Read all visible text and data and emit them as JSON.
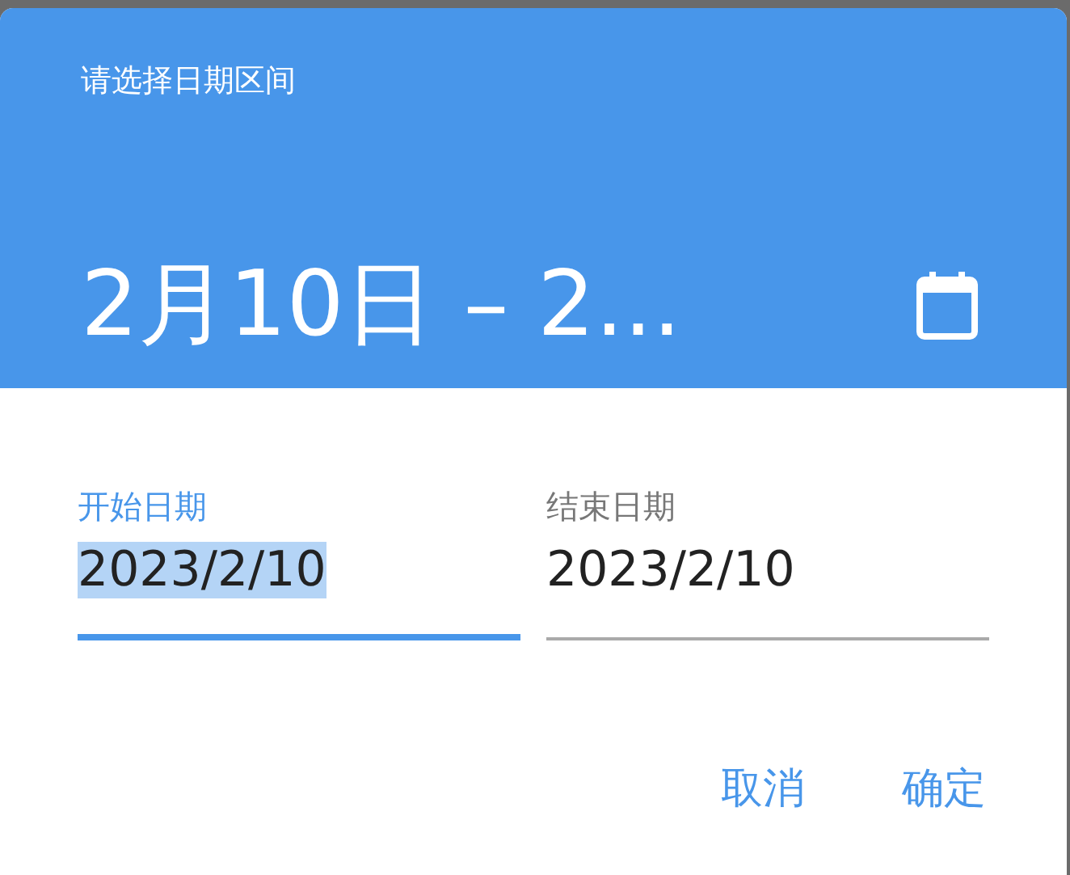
{
  "dialog": {
    "title": "请选择日期区间",
    "range_display": "2月10日 – 2...",
    "fields": [
      {
        "label": "开始日期",
        "value": "2023/2/10",
        "focused": true,
        "text_selected": true
      },
      {
        "label": "结束日期",
        "value": "2023/2/10",
        "focused": false,
        "text_selected": false
      }
    ],
    "buttons": [
      "取消",
      "确定"
    ]
  }
}
